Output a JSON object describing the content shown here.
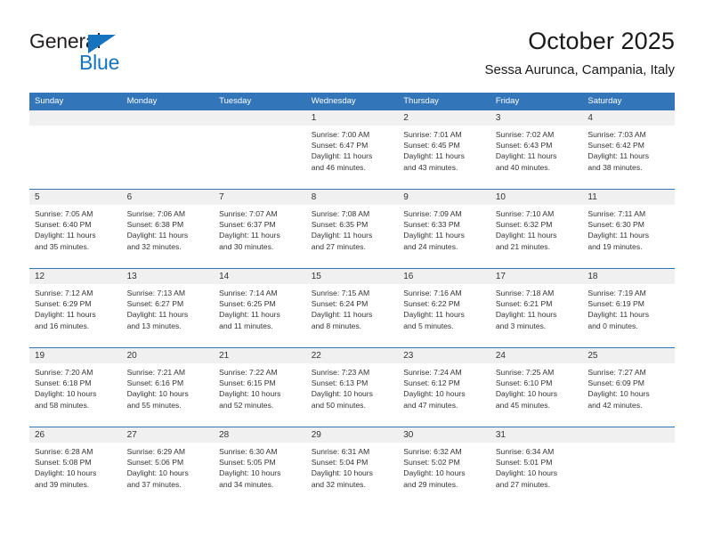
{
  "brand": {
    "name_top": "General",
    "name_bottom": "Blue",
    "accent_color": "#1574bf"
  },
  "header": {
    "title": "October 2025",
    "subtitle": "Sessa Aurunca, Campania, Italy"
  },
  "theme": {
    "header_blue": "#3275b9",
    "daynum_band": "#f0f0f0",
    "text": "#333333"
  },
  "weekday_headers": [
    "Sunday",
    "Monday",
    "Tuesday",
    "Wednesday",
    "Thursday",
    "Friday",
    "Saturday"
  ],
  "labels": {
    "sunrise_prefix": "Sunrise:",
    "sunset_prefix": "Sunset:",
    "daylight_prefix": "Daylight:"
  },
  "weeks": [
    [
      {
        "day": "",
        "line1": "",
        "line2": "",
        "line3": "",
        "line4": ""
      },
      {
        "day": "",
        "line1": "",
        "line2": "",
        "line3": "",
        "line4": ""
      },
      {
        "day": "",
        "line1": "",
        "line2": "",
        "line3": "",
        "line4": ""
      },
      {
        "day": "1",
        "line1": "Sunrise: 7:00 AM",
        "line2": "Sunset: 6:47 PM",
        "line3": "Daylight: 11 hours",
        "line4": "and 46 minutes."
      },
      {
        "day": "2",
        "line1": "Sunrise: 7:01 AM",
        "line2": "Sunset: 6:45 PM",
        "line3": "Daylight: 11 hours",
        "line4": "and 43 minutes."
      },
      {
        "day": "3",
        "line1": "Sunrise: 7:02 AM",
        "line2": "Sunset: 6:43 PM",
        "line3": "Daylight: 11 hours",
        "line4": "and 40 minutes."
      },
      {
        "day": "4",
        "line1": "Sunrise: 7:03 AM",
        "line2": "Sunset: 6:42 PM",
        "line3": "Daylight: 11 hours",
        "line4": "and 38 minutes."
      }
    ],
    [
      {
        "day": "5",
        "line1": "Sunrise: 7:05 AM",
        "line2": "Sunset: 6:40 PM",
        "line3": "Daylight: 11 hours",
        "line4": "and 35 minutes."
      },
      {
        "day": "6",
        "line1": "Sunrise: 7:06 AM",
        "line2": "Sunset: 6:38 PM",
        "line3": "Daylight: 11 hours",
        "line4": "and 32 minutes."
      },
      {
        "day": "7",
        "line1": "Sunrise: 7:07 AM",
        "line2": "Sunset: 6:37 PM",
        "line3": "Daylight: 11 hours",
        "line4": "and 30 minutes."
      },
      {
        "day": "8",
        "line1": "Sunrise: 7:08 AM",
        "line2": "Sunset: 6:35 PM",
        "line3": "Daylight: 11 hours",
        "line4": "and 27 minutes."
      },
      {
        "day": "9",
        "line1": "Sunrise: 7:09 AM",
        "line2": "Sunset: 6:33 PM",
        "line3": "Daylight: 11 hours",
        "line4": "and 24 minutes."
      },
      {
        "day": "10",
        "line1": "Sunrise: 7:10 AM",
        "line2": "Sunset: 6:32 PM",
        "line3": "Daylight: 11 hours",
        "line4": "and 21 minutes."
      },
      {
        "day": "11",
        "line1": "Sunrise: 7:11 AM",
        "line2": "Sunset: 6:30 PM",
        "line3": "Daylight: 11 hours",
        "line4": "and 19 minutes."
      }
    ],
    [
      {
        "day": "12",
        "line1": "Sunrise: 7:12 AM",
        "line2": "Sunset: 6:29 PM",
        "line3": "Daylight: 11 hours",
        "line4": "and 16 minutes."
      },
      {
        "day": "13",
        "line1": "Sunrise: 7:13 AM",
        "line2": "Sunset: 6:27 PM",
        "line3": "Daylight: 11 hours",
        "line4": "and 13 minutes."
      },
      {
        "day": "14",
        "line1": "Sunrise: 7:14 AM",
        "line2": "Sunset: 6:25 PM",
        "line3": "Daylight: 11 hours",
        "line4": "and 11 minutes."
      },
      {
        "day": "15",
        "line1": "Sunrise: 7:15 AM",
        "line2": "Sunset: 6:24 PM",
        "line3": "Daylight: 11 hours",
        "line4": "and 8 minutes."
      },
      {
        "day": "16",
        "line1": "Sunrise: 7:16 AM",
        "line2": "Sunset: 6:22 PM",
        "line3": "Daylight: 11 hours",
        "line4": "and 5 minutes."
      },
      {
        "day": "17",
        "line1": "Sunrise: 7:18 AM",
        "line2": "Sunset: 6:21 PM",
        "line3": "Daylight: 11 hours",
        "line4": "and 3 minutes."
      },
      {
        "day": "18",
        "line1": "Sunrise: 7:19 AM",
        "line2": "Sunset: 6:19 PM",
        "line3": "Daylight: 11 hours",
        "line4": "and 0 minutes."
      }
    ],
    [
      {
        "day": "19",
        "line1": "Sunrise: 7:20 AM",
        "line2": "Sunset: 6:18 PM",
        "line3": "Daylight: 10 hours",
        "line4": "and 58 minutes."
      },
      {
        "day": "20",
        "line1": "Sunrise: 7:21 AM",
        "line2": "Sunset: 6:16 PM",
        "line3": "Daylight: 10 hours",
        "line4": "and 55 minutes."
      },
      {
        "day": "21",
        "line1": "Sunrise: 7:22 AM",
        "line2": "Sunset: 6:15 PM",
        "line3": "Daylight: 10 hours",
        "line4": "and 52 minutes."
      },
      {
        "day": "22",
        "line1": "Sunrise: 7:23 AM",
        "line2": "Sunset: 6:13 PM",
        "line3": "Daylight: 10 hours",
        "line4": "and 50 minutes."
      },
      {
        "day": "23",
        "line1": "Sunrise: 7:24 AM",
        "line2": "Sunset: 6:12 PM",
        "line3": "Daylight: 10 hours",
        "line4": "and 47 minutes."
      },
      {
        "day": "24",
        "line1": "Sunrise: 7:25 AM",
        "line2": "Sunset: 6:10 PM",
        "line3": "Daylight: 10 hours",
        "line4": "and 45 minutes."
      },
      {
        "day": "25",
        "line1": "Sunrise: 7:27 AM",
        "line2": "Sunset: 6:09 PM",
        "line3": "Daylight: 10 hours",
        "line4": "and 42 minutes."
      }
    ],
    [
      {
        "day": "26",
        "line1": "Sunrise: 6:28 AM",
        "line2": "Sunset: 5:08 PM",
        "line3": "Daylight: 10 hours",
        "line4": "and 39 minutes."
      },
      {
        "day": "27",
        "line1": "Sunrise: 6:29 AM",
        "line2": "Sunset: 5:06 PM",
        "line3": "Daylight: 10 hours",
        "line4": "and 37 minutes."
      },
      {
        "day": "28",
        "line1": "Sunrise: 6:30 AM",
        "line2": "Sunset: 5:05 PM",
        "line3": "Daylight: 10 hours",
        "line4": "and 34 minutes."
      },
      {
        "day": "29",
        "line1": "Sunrise: 6:31 AM",
        "line2": "Sunset: 5:04 PM",
        "line3": "Daylight: 10 hours",
        "line4": "and 32 minutes."
      },
      {
        "day": "30",
        "line1": "Sunrise: 6:32 AM",
        "line2": "Sunset: 5:02 PM",
        "line3": "Daylight: 10 hours",
        "line4": "and 29 minutes."
      },
      {
        "day": "31",
        "line1": "Sunrise: 6:34 AM",
        "line2": "Sunset: 5:01 PM",
        "line3": "Daylight: 10 hours",
        "line4": "and 27 minutes."
      },
      {
        "day": "",
        "line1": "",
        "line2": "",
        "line3": "",
        "line4": ""
      }
    ]
  ]
}
